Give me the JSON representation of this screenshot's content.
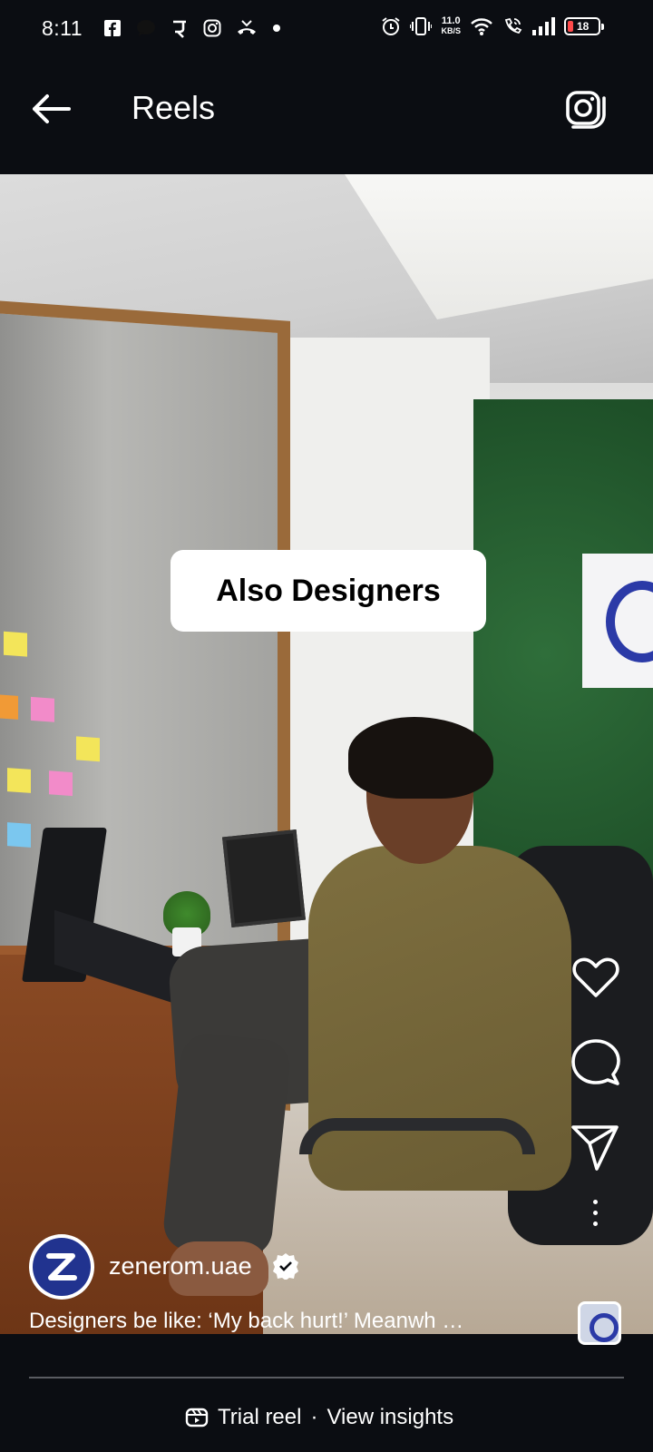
{
  "status_bar": {
    "time": "8:11",
    "net_speed": "11.0",
    "net_speed_unit": "KB/S",
    "battery": "18",
    "left_icons": [
      "facebook-icon",
      "chat-bubble-icon",
      "pe-icon",
      "instagram-icon",
      "missed-call-icon",
      "dot-icon"
    ],
    "right_icons": [
      "alarm-icon",
      "vibrate-icon",
      "wifi-icon",
      "wifi-calling-icon",
      "signal-icon",
      "battery-icon"
    ]
  },
  "header": {
    "title": "Reels",
    "back_icon": "arrow-left-icon",
    "camera_icon": "camera-icon"
  },
  "reel": {
    "overlay_text": "Also Designers",
    "author": "zenerom.uae",
    "caption": "Designers be like: ‘My back hurt!’ Meanwh …",
    "verified": true
  },
  "actions": [
    "heart-icon",
    "comment-icon",
    "send-icon",
    "more-icon"
  ],
  "footer": {
    "trial_reel": "Trial reel",
    "separator": "·",
    "view_insights": "View insights"
  },
  "colors": {
    "background": "#0b0d12",
    "brand_blue": "#21338f",
    "battery_low": "#ff4b4b"
  }
}
